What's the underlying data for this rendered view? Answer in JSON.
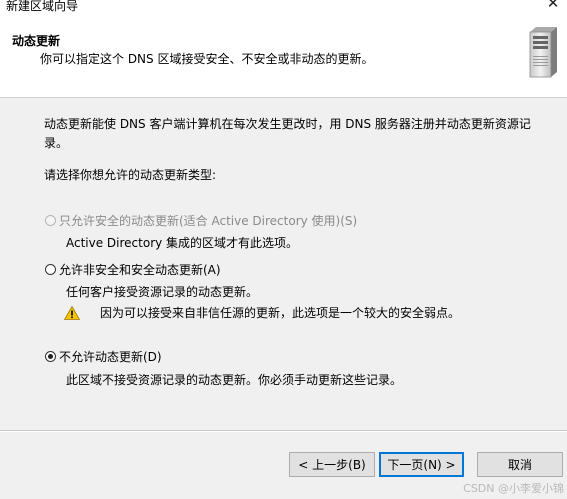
{
  "window": {
    "title": "新建区域向导",
    "close_icon": "close-icon"
  },
  "header": {
    "title": "动态更新",
    "subtitle": "你可以指定这个 DNS 区域接受安全、不安全或非动态的更新。",
    "icon": "server-icon"
  },
  "content": {
    "intro": "动态更新能使 DNS 客户端计算机在每次发生更改时，用 DNS 服务器注册并动态更新资源记录。",
    "prompt": "请选择你想允许的动态更新类型:",
    "options": [
      {
        "label": "只允许安全的动态更新(适合 Active Directory 使用)(S)",
        "description": "Active Directory 集成的区域才有此选项。",
        "selected": false,
        "enabled": false
      },
      {
        "label": "允许非安全和安全动态更新(A)",
        "description": "任何客户接受资源记录的动态更新。",
        "warning": "因为可以接受来自非信任源的更新，此选项是一个较大的安全弱点。",
        "warning_icon": "warning-icon",
        "selected": false,
        "enabled": true
      },
      {
        "label": "不允许动态更新(D)",
        "description": "此区域不接受资源记录的动态更新。你必须手动更新这些记录。",
        "selected": true,
        "enabled": true
      }
    ]
  },
  "buttons": {
    "back": "< 上一步(B)",
    "next": "下一页(N) >",
    "cancel": "取消"
  },
  "watermark": "CSDN @小李爱小锦",
  "colors": {
    "focus_border": "#0078d7",
    "warning_yellow": "#f5c400",
    "button_bg": "#e1e1e1"
  }
}
